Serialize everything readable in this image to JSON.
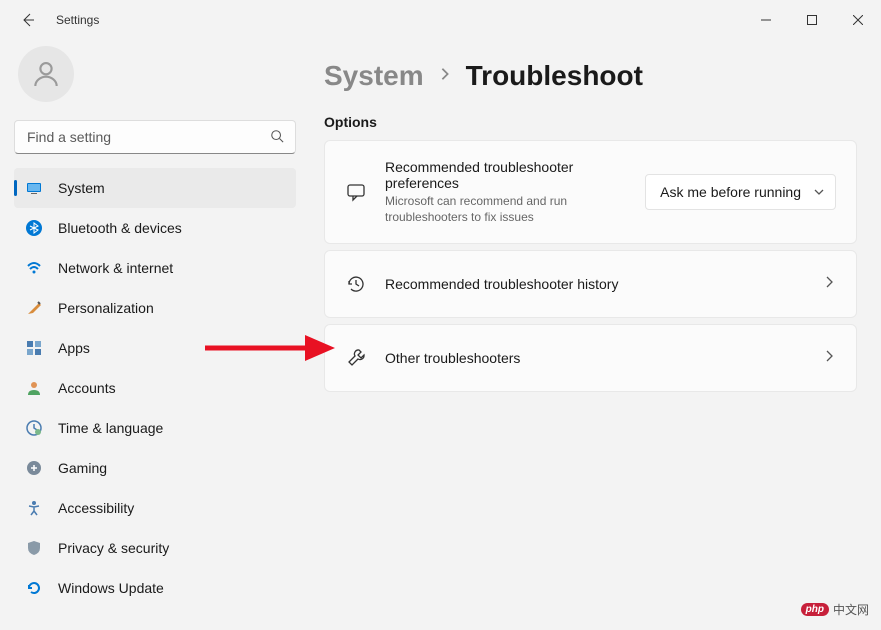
{
  "window": {
    "title": "Settings"
  },
  "search": {
    "placeholder": "Find a setting"
  },
  "sidebar": {
    "items": [
      {
        "label": "System"
      },
      {
        "label": "Bluetooth & devices"
      },
      {
        "label": "Network & internet"
      },
      {
        "label": "Personalization"
      },
      {
        "label": "Apps"
      },
      {
        "label": "Accounts"
      },
      {
        "label": "Time & language"
      },
      {
        "label": "Gaming"
      },
      {
        "label": "Accessibility"
      },
      {
        "label": "Privacy & security"
      },
      {
        "label": "Windows Update"
      }
    ]
  },
  "breadcrumb": {
    "parent": "System",
    "current": "Troubleshoot"
  },
  "section": {
    "heading": "Options"
  },
  "options": {
    "recommended_prefs": {
      "title": "Recommended troubleshooter preferences",
      "subtitle": "Microsoft can recommend and run troubleshooters to fix issues",
      "dropdown_value": "Ask me before running"
    },
    "history": {
      "title": "Recommended troubleshooter history"
    },
    "other": {
      "title": "Other troubleshooters"
    }
  },
  "watermark": {
    "badge": "php",
    "text": "中文网"
  }
}
